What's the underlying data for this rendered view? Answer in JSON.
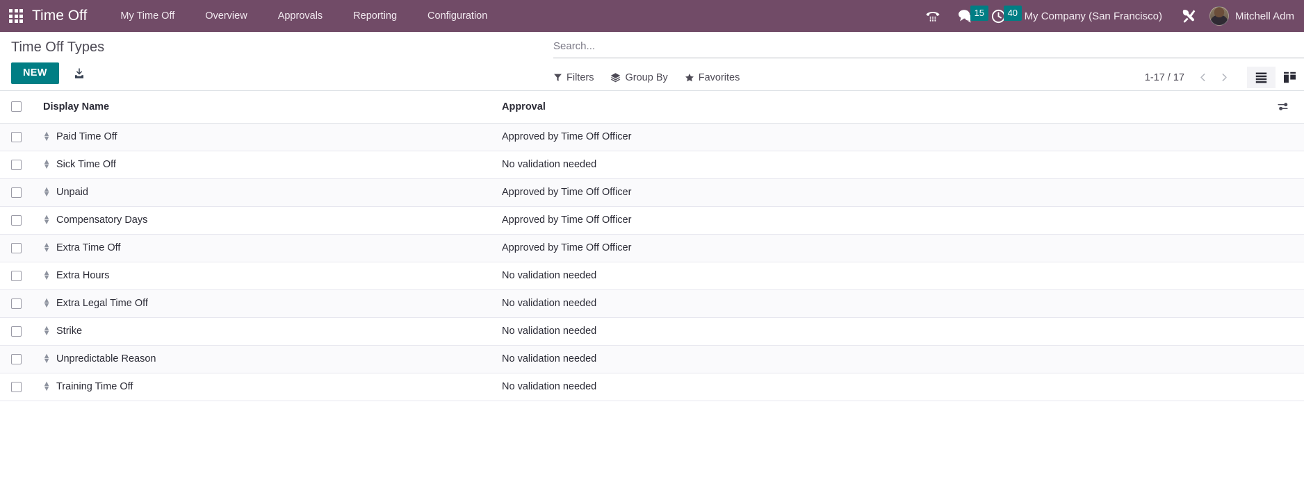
{
  "navbar": {
    "apps_icon": "apps-grid-icon",
    "brand": "Time Off",
    "menu_items": [
      {
        "label": "My Time Off"
      },
      {
        "label": "Overview"
      },
      {
        "label": "Approvals"
      },
      {
        "label": "Reporting"
      },
      {
        "label": "Configuration"
      }
    ],
    "systray": {
      "voip_icon": "phone-dialpad-icon",
      "messages_icon": "chat-bubble-icon",
      "messages_count": "15",
      "activities_icon": "clock-icon",
      "activities_count": "40",
      "company": "My Company (San Francisco)",
      "debug_icon": "tools-wrench-icon",
      "user_name": "Mitchell Adm",
      "avatar": "user-avatar"
    },
    "colors": {
      "background": "#714B67",
      "badge": "#017E84",
      "text": "#FFFFFF"
    }
  },
  "control_panel": {
    "title": "Time Off Types",
    "new_label": "NEW",
    "import_icon": "import-download-icon",
    "accent_color": "#017E84"
  },
  "search": {
    "placeholder": "Search...",
    "value": "",
    "filters_label": "Filters",
    "filters_icon": "funnel-icon",
    "group_by_label": "Group By",
    "group_by_icon": "layers-icon",
    "favorites_label": "Favorites",
    "favorites_icon": "star-icon"
  },
  "pager": {
    "range": "1-17 / 17",
    "prev_icon": "chevron-left-icon",
    "next_icon": "chevron-right-icon"
  },
  "view_switcher": {
    "views": [
      {
        "name": "list",
        "icon": "list-view-icon",
        "active": true
      },
      {
        "name": "kanban",
        "icon": "kanban-view-icon",
        "active": false
      }
    ]
  },
  "table": {
    "select_all_checkbox": false,
    "optional_columns_icon": "sliders-toggle-icon",
    "columns": [
      {
        "key": "display_name",
        "label": "Display Name"
      },
      {
        "key": "approval",
        "label": "Approval"
      }
    ],
    "rows": [
      {
        "display_name": "Paid Time Off",
        "approval": "Approved by Time Off Officer",
        "checked": false
      },
      {
        "display_name": "Sick Time Off",
        "approval": "No validation needed",
        "checked": false
      },
      {
        "display_name": "Unpaid",
        "approval": "Approved by Time Off Officer",
        "checked": false
      },
      {
        "display_name": "Compensatory Days",
        "approval": "Approved by Time Off Officer",
        "checked": false
      },
      {
        "display_name": "Extra Time Off",
        "approval": "Approved by Time Off Officer",
        "checked": false
      },
      {
        "display_name": "Extra Hours",
        "approval": "No validation needed",
        "checked": false
      },
      {
        "display_name": "Extra Legal Time Off",
        "approval": "No validation needed",
        "checked": false
      },
      {
        "display_name": "Strike",
        "approval": "No validation needed",
        "checked": false
      },
      {
        "display_name": "Unpredictable Reason",
        "approval": "No validation needed",
        "checked": false
      },
      {
        "display_name": "Training Time Off",
        "approval": "No validation needed",
        "checked": false
      }
    ]
  }
}
